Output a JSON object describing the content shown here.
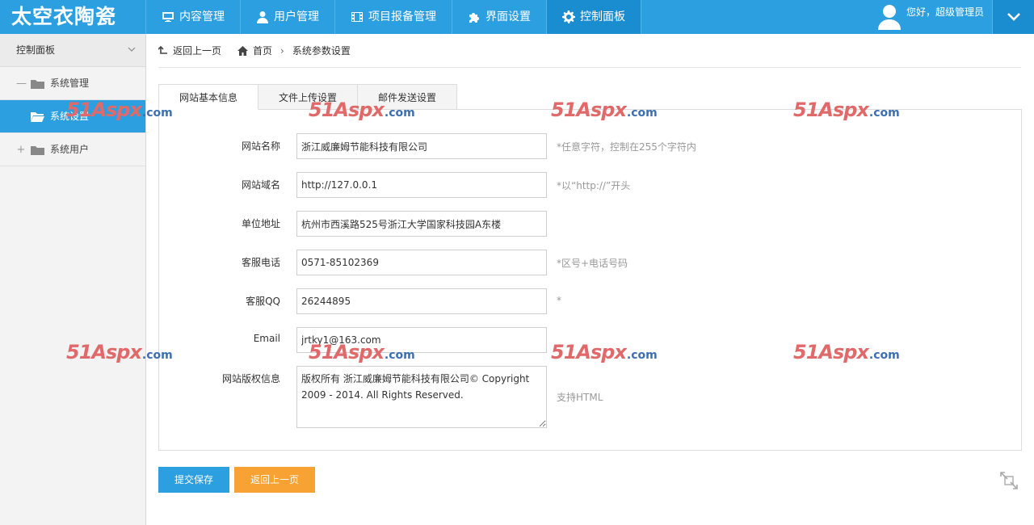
{
  "app": {
    "title": "太空衣陶瓷"
  },
  "nav": [
    {
      "label": "内容管理",
      "icon": "monitor-icon"
    },
    {
      "label": "用户管理",
      "icon": "user-icon"
    },
    {
      "label": "项目报备管理",
      "icon": "film-icon"
    },
    {
      "label": "界面设置",
      "icon": "puzzle-icon"
    },
    {
      "label": "控制面板",
      "icon": "gear-icon",
      "active": true
    }
  ],
  "user": {
    "greeting": "您好，超级管理员"
  },
  "sidebar": {
    "header": "控制面板",
    "items": [
      {
        "label": "系统管理",
        "toggle": "—",
        "icon": "folder-icon"
      },
      {
        "label": "系统设置",
        "icon": "folder-open-icon",
        "active": true
      },
      {
        "label": "系统用户",
        "toggle": "+",
        "icon": "folder-icon"
      }
    ]
  },
  "breadcrumb": {
    "back": "返回上一页",
    "home": "首页",
    "separator": "›",
    "current": "系统参数设置"
  },
  "tabs": [
    {
      "label": "网站基本信息",
      "active": true
    },
    {
      "label": "文件上传设置"
    },
    {
      "label": "邮件发送设置"
    }
  ],
  "form": {
    "site_name": {
      "label": "网站名称",
      "value": "浙江威廉姆节能科技有限公司",
      "hint": "*任意字符，控制在255个字符内"
    },
    "site_domain": {
      "label": "网站域名",
      "value": "http://127.0.0.1",
      "hint": "*以“http://”开头"
    },
    "address": {
      "label": "单位地址",
      "value": "杭州市西溪路525号浙江大学国家科技园A东楼",
      "hint": ""
    },
    "phone": {
      "label": "客服电话",
      "value": "0571-85102369",
      "hint": "*区号+电话号码"
    },
    "qq": {
      "label": "客服QQ",
      "value": "26244895",
      "hint": "*"
    },
    "email": {
      "label": "Email",
      "value": "jrtky1@163.com",
      "hint": ""
    },
    "copyright": {
      "label": "网站版权信息",
      "value": "版权所有 浙江威廉姆节能科技有限公司© Copyright 2009 - 2014. All Rights Reserved.",
      "hint": "支持HTML"
    }
  },
  "buttons": {
    "save": "提交保存",
    "back": "返回上一页"
  },
  "watermark": {
    "brand": "51Aspx",
    "domain": ".com"
  },
  "colors": {
    "primary": "#2b9fe0",
    "primary_dark": "#1a8dd0",
    "orange": "#f7a232"
  }
}
